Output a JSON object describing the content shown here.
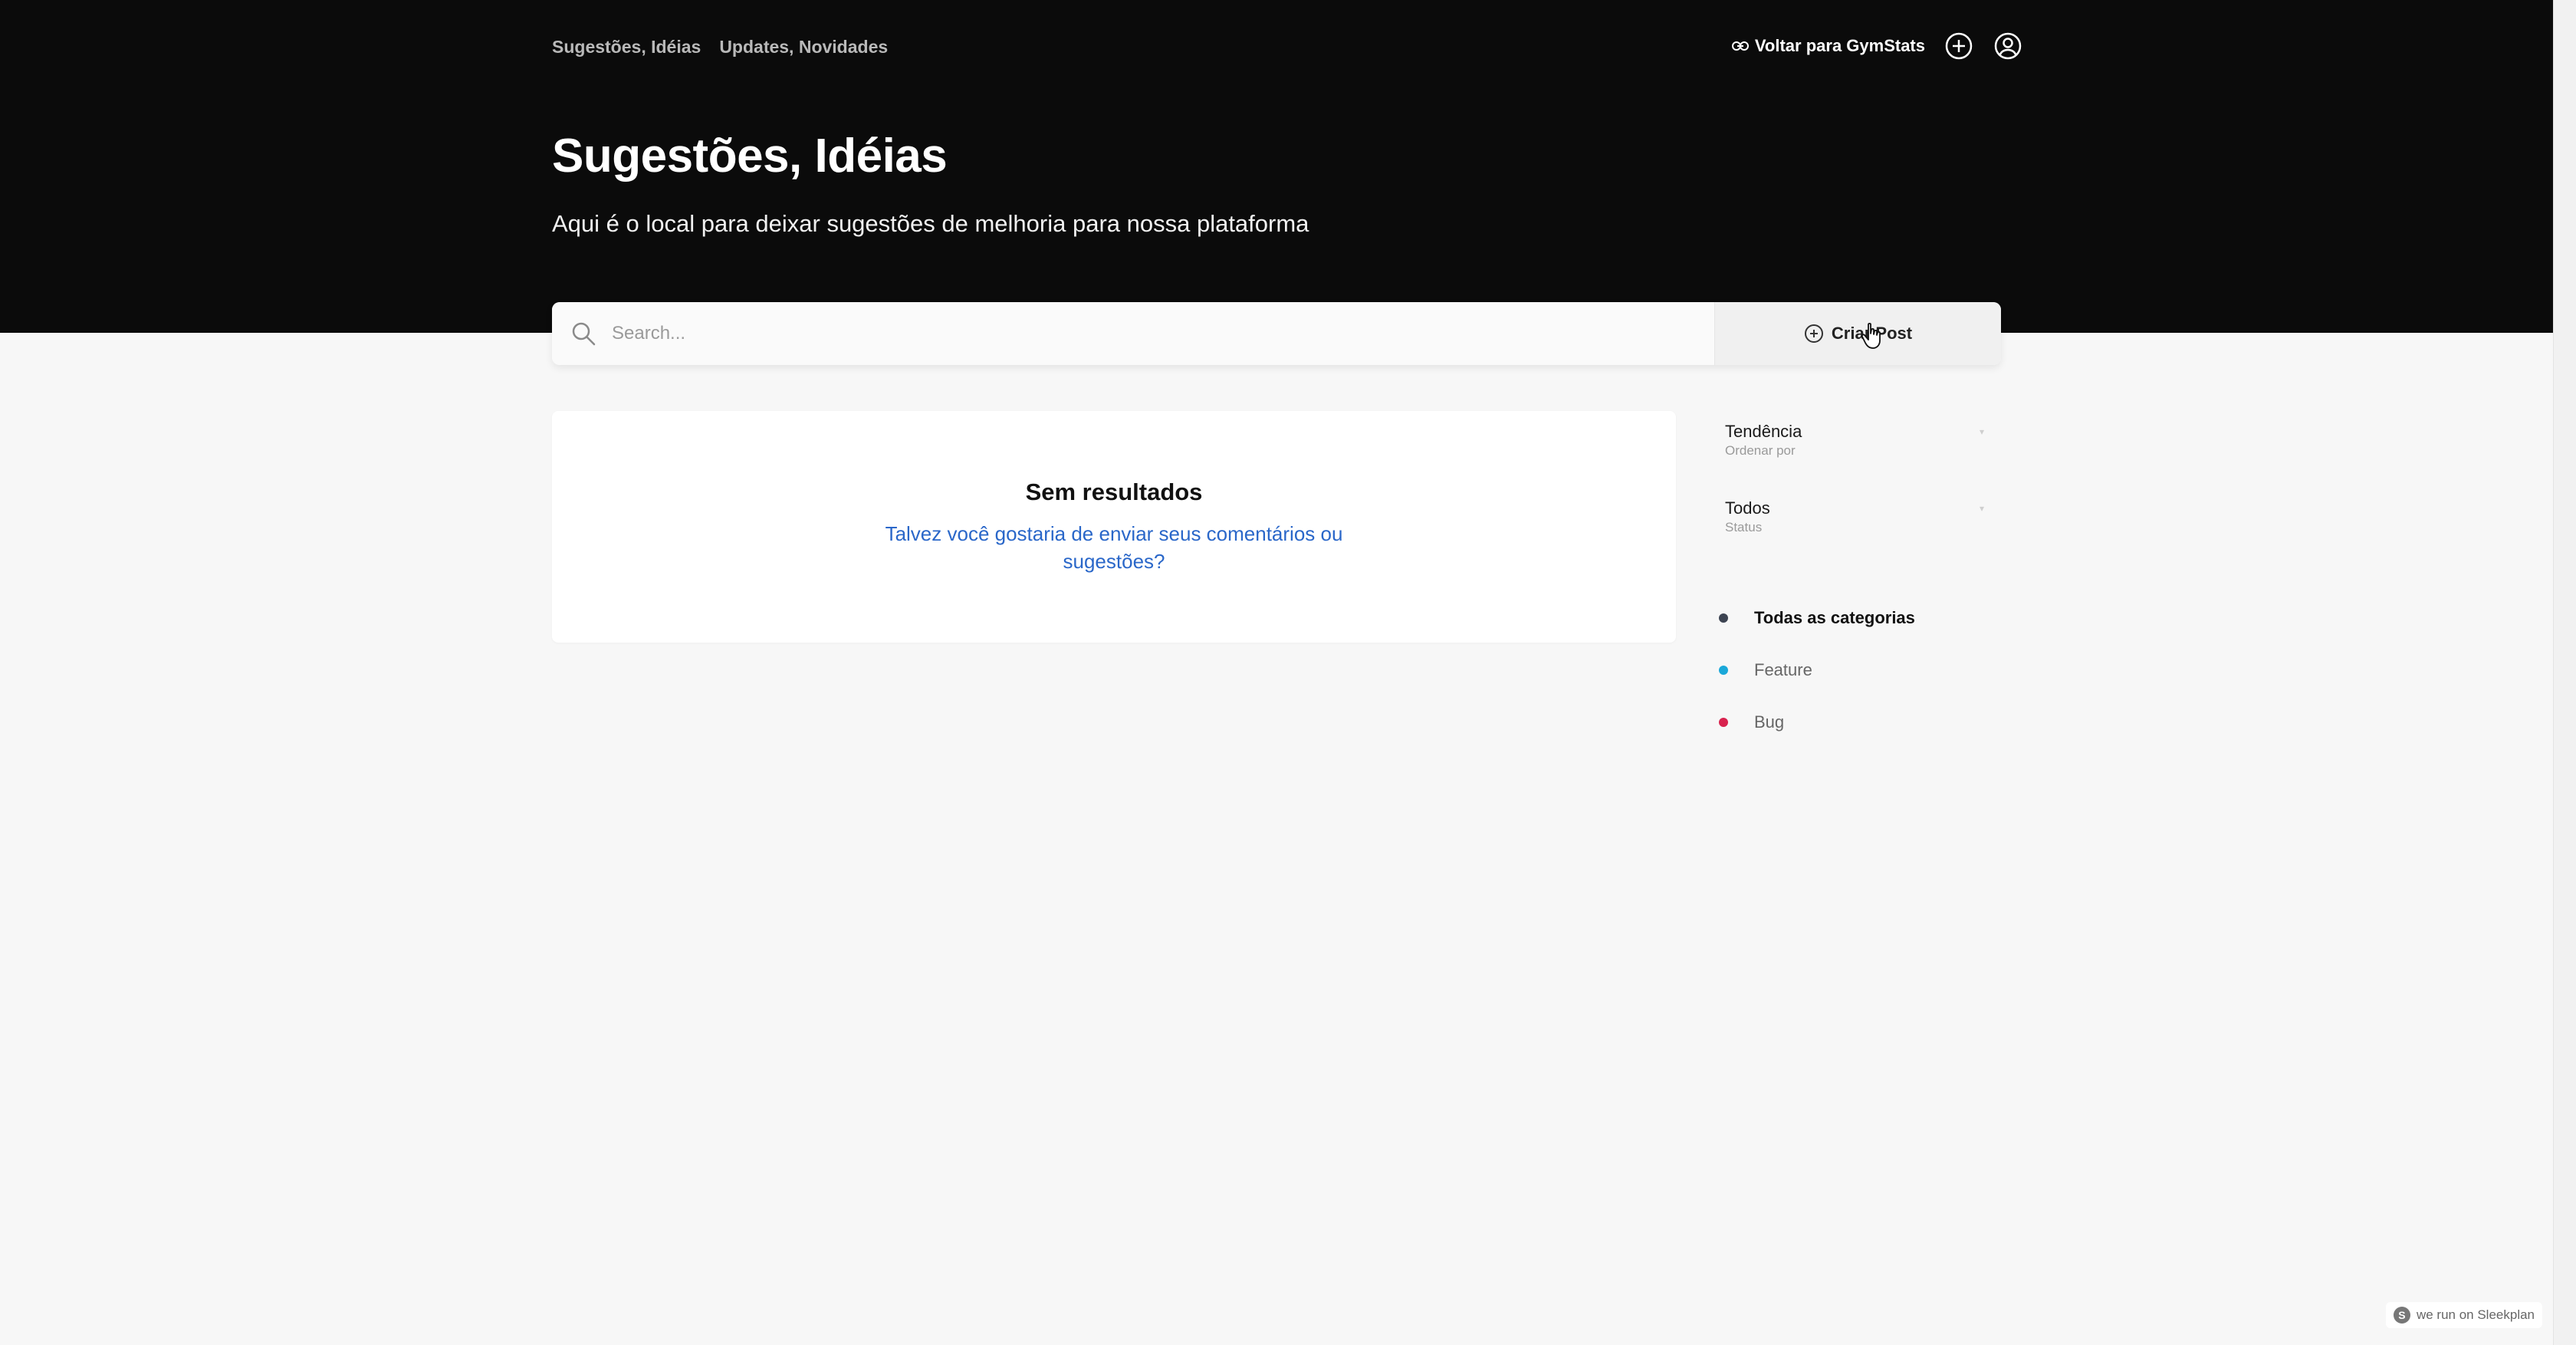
{
  "nav": {
    "items": [
      {
        "label": "Sugestões, Idéias"
      },
      {
        "label": "Updates, Novidades"
      }
    ]
  },
  "toolbar": {
    "back_label": "Voltar para GymStats"
  },
  "header": {
    "title": "Sugestões, Idéias",
    "subtitle": "Aqui é o local para deixar sugestões de melhoria para nossa plataforma"
  },
  "search": {
    "placeholder": "Search...",
    "create_label": "Criar Post"
  },
  "results": {
    "title": "Sem resultados",
    "link": "Talvez você gostaria de enviar seus comentários ou sugestões?"
  },
  "sidebar": {
    "sort": {
      "value": "Tendência",
      "label": "Ordenar por"
    },
    "status": {
      "value": "Todos",
      "label": "Status"
    },
    "categories": [
      {
        "label": "Todas as categorias",
        "color": "#3d4452"
      },
      {
        "label": "Feature",
        "color": "#1aa8d9"
      },
      {
        "label": "Bug",
        "color": "#d8234f"
      }
    ]
  },
  "footer": {
    "badge": "we run on Sleekplan",
    "badge_logo": "S"
  },
  "colors": {
    "hero_bg": "#0b0b0b",
    "page_bg": "#f7f7f7",
    "link": "#2a67c9"
  },
  "icons": [
    "link-icon",
    "plus-circle-icon",
    "user-icon",
    "search-icon",
    "hand-cursor-icon"
  ]
}
